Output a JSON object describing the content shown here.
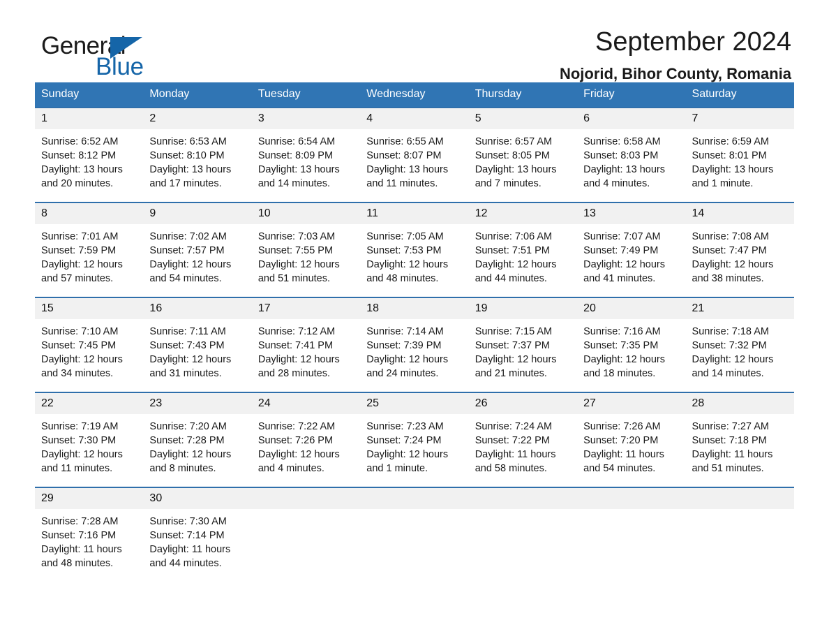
{
  "brand": {
    "name_part1": "General",
    "name_part2": "Blue",
    "triangle_color": "#1565a8",
    "icon": "triangle-icon"
  },
  "header": {
    "title": "September 2024",
    "location": "Nojorid, Bihor County, Romania"
  },
  "colors": {
    "header_blue": "#3075b4",
    "row_divider_blue": "#2f6fab",
    "daynum_band": "#f1f1f1",
    "brand_blue": "#1565a8",
    "text": "#1a1a1a"
  },
  "calendar": {
    "weekday_headers": [
      "Sunday",
      "Monday",
      "Tuesday",
      "Wednesday",
      "Thursday",
      "Friday",
      "Saturday"
    ],
    "weeks": [
      [
        {
          "day": "1",
          "sunrise": "Sunrise: 6:52 AM",
          "sunset": "Sunset: 8:12 PM",
          "daylight_line1": "Daylight: 13 hours",
          "daylight_line2": "and 20 minutes."
        },
        {
          "day": "2",
          "sunrise": "Sunrise: 6:53 AM",
          "sunset": "Sunset: 8:10 PM",
          "daylight_line1": "Daylight: 13 hours",
          "daylight_line2": "and 17 minutes."
        },
        {
          "day": "3",
          "sunrise": "Sunrise: 6:54 AM",
          "sunset": "Sunset: 8:09 PM",
          "daylight_line1": "Daylight: 13 hours",
          "daylight_line2": "and 14 minutes."
        },
        {
          "day": "4",
          "sunrise": "Sunrise: 6:55 AM",
          "sunset": "Sunset: 8:07 PM",
          "daylight_line1": "Daylight: 13 hours",
          "daylight_line2": "and 11 minutes."
        },
        {
          "day": "5",
          "sunrise": "Sunrise: 6:57 AM",
          "sunset": "Sunset: 8:05 PM",
          "daylight_line1": "Daylight: 13 hours",
          "daylight_line2": "and 7 minutes."
        },
        {
          "day": "6",
          "sunrise": "Sunrise: 6:58 AM",
          "sunset": "Sunset: 8:03 PM",
          "daylight_line1": "Daylight: 13 hours",
          "daylight_line2": "and 4 minutes."
        },
        {
          "day": "7",
          "sunrise": "Sunrise: 6:59 AM",
          "sunset": "Sunset: 8:01 PM",
          "daylight_line1": "Daylight: 13 hours",
          "daylight_line2": "and 1 minute."
        }
      ],
      [
        {
          "day": "8",
          "sunrise": "Sunrise: 7:01 AM",
          "sunset": "Sunset: 7:59 PM",
          "daylight_line1": "Daylight: 12 hours",
          "daylight_line2": "and 57 minutes."
        },
        {
          "day": "9",
          "sunrise": "Sunrise: 7:02 AM",
          "sunset": "Sunset: 7:57 PM",
          "daylight_line1": "Daylight: 12 hours",
          "daylight_line2": "and 54 minutes."
        },
        {
          "day": "10",
          "sunrise": "Sunrise: 7:03 AM",
          "sunset": "Sunset: 7:55 PM",
          "daylight_line1": "Daylight: 12 hours",
          "daylight_line2": "and 51 minutes."
        },
        {
          "day": "11",
          "sunrise": "Sunrise: 7:05 AM",
          "sunset": "Sunset: 7:53 PM",
          "daylight_line1": "Daylight: 12 hours",
          "daylight_line2": "and 48 minutes."
        },
        {
          "day": "12",
          "sunrise": "Sunrise: 7:06 AM",
          "sunset": "Sunset: 7:51 PM",
          "daylight_line1": "Daylight: 12 hours",
          "daylight_line2": "and 44 minutes."
        },
        {
          "day": "13",
          "sunrise": "Sunrise: 7:07 AM",
          "sunset": "Sunset: 7:49 PM",
          "daylight_line1": "Daylight: 12 hours",
          "daylight_line2": "and 41 minutes."
        },
        {
          "day": "14",
          "sunrise": "Sunrise: 7:08 AM",
          "sunset": "Sunset: 7:47 PM",
          "daylight_line1": "Daylight: 12 hours",
          "daylight_line2": "and 38 minutes."
        }
      ],
      [
        {
          "day": "15",
          "sunrise": "Sunrise: 7:10 AM",
          "sunset": "Sunset: 7:45 PM",
          "daylight_line1": "Daylight: 12 hours",
          "daylight_line2": "and 34 minutes."
        },
        {
          "day": "16",
          "sunrise": "Sunrise: 7:11 AM",
          "sunset": "Sunset: 7:43 PM",
          "daylight_line1": "Daylight: 12 hours",
          "daylight_line2": "and 31 minutes."
        },
        {
          "day": "17",
          "sunrise": "Sunrise: 7:12 AM",
          "sunset": "Sunset: 7:41 PM",
          "daylight_line1": "Daylight: 12 hours",
          "daylight_line2": "and 28 minutes."
        },
        {
          "day": "18",
          "sunrise": "Sunrise: 7:14 AM",
          "sunset": "Sunset: 7:39 PM",
          "daylight_line1": "Daylight: 12 hours",
          "daylight_line2": "and 24 minutes."
        },
        {
          "day": "19",
          "sunrise": "Sunrise: 7:15 AM",
          "sunset": "Sunset: 7:37 PM",
          "daylight_line1": "Daylight: 12 hours",
          "daylight_line2": "and 21 minutes."
        },
        {
          "day": "20",
          "sunrise": "Sunrise: 7:16 AM",
          "sunset": "Sunset: 7:35 PM",
          "daylight_line1": "Daylight: 12 hours",
          "daylight_line2": "and 18 minutes."
        },
        {
          "day": "21",
          "sunrise": "Sunrise: 7:18 AM",
          "sunset": "Sunset: 7:32 PM",
          "daylight_line1": "Daylight: 12 hours",
          "daylight_line2": "and 14 minutes."
        }
      ],
      [
        {
          "day": "22",
          "sunrise": "Sunrise: 7:19 AM",
          "sunset": "Sunset: 7:30 PM",
          "daylight_line1": "Daylight: 12 hours",
          "daylight_line2": "and 11 minutes."
        },
        {
          "day": "23",
          "sunrise": "Sunrise: 7:20 AM",
          "sunset": "Sunset: 7:28 PM",
          "daylight_line1": "Daylight: 12 hours",
          "daylight_line2": "and 8 minutes."
        },
        {
          "day": "24",
          "sunrise": "Sunrise: 7:22 AM",
          "sunset": "Sunset: 7:26 PM",
          "daylight_line1": "Daylight: 12 hours",
          "daylight_line2": "and 4 minutes."
        },
        {
          "day": "25",
          "sunrise": "Sunrise: 7:23 AM",
          "sunset": "Sunset: 7:24 PM",
          "daylight_line1": "Daylight: 12 hours",
          "daylight_line2": "and 1 minute."
        },
        {
          "day": "26",
          "sunrise": "Sunrise: 7:24 AM",
          "sunset": "Sunset: 7:22 PM",
          "daylight_line1": "Daylight: 11 hours",
          "daylight_line2": "and 58 minutes."
        },
        {
          "day": "27",
          "sunrise": "Sunrise: 7:26 AM",
          "sunset": "Sunset: 7:20 PM",
          "daylight_line1": "Daylight: 11 hours",
          "daylight_line2": "and 54 minutes."
        },
        {
          "day": "28",
          "sunrise": "Sunrise: 7:27 AM",
          "sunset": "Sunset: 7:18 PM",
          "daylight_line1": "Daylight: 11 hours",
          "daylight_line2": "and 51 minutes."
        }
      ],
      [
        {
          "day": "29",
          "sunrise": "Sunrise: 7:28 AM",
          "sunset": "Sunset: 7:16 PM",
          "daylight_line1": "Daylight: 11 hours",
          "daylight_line2": "and 48 minutes."
        },
        {
          "day": "30",
          "sunrise": "Sunrise: 7:30 AM",
          "sunset": "Sunset: 7:14 PM",
          "daylight_line1": "Daylight: 11 hours",
          "daylight_line2": "and 44 minutes."
        },
        {
          "day": "",
          "sunrise": "",
          "sunset": "",
          "daylight_line1": "",
          "daylight_line2": ""
        },
        {
          "day": "",
          "sunrise": "",
          "sunset": "",
          "daylight_line1": "",
          "daylight_line2": ""
        },
        {
          "day": "",
          "sunrise": "",
          "sunset": "",
          "daylight_line1": "",
          "daylight_line2": ""
        },
        {
          "day": "",
          "sunrise": "",
          "sunset": "",
          "daylight_line1": "",
          "daylight_line2": ""
        },
        {
          "day": "",
          "sunrise": "",
          "sunset": "",
          "daylight_line1": "",
          "daylight_line2": ""
        }
      ]
    ]
  }
}
